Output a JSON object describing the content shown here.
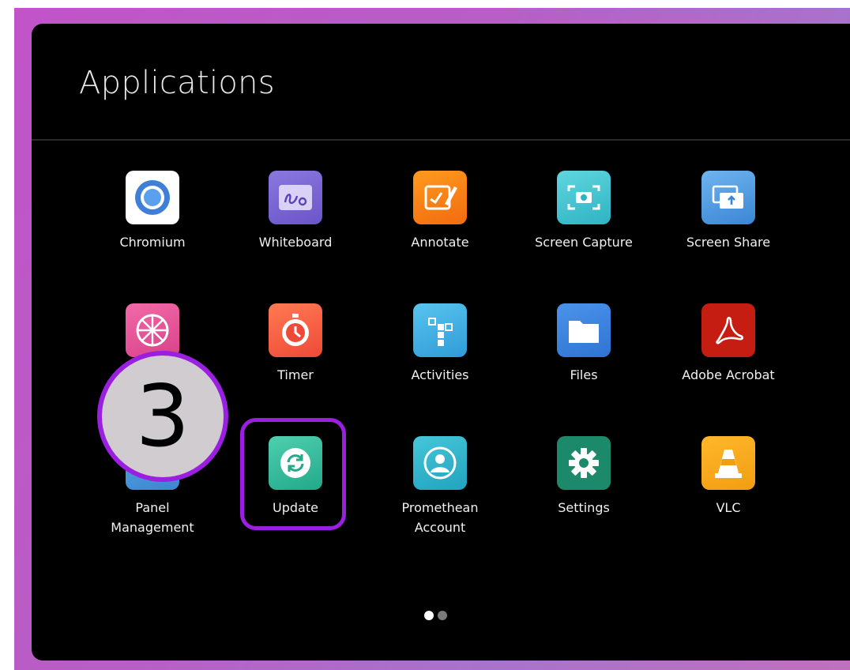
{
  "header": {
    "title": "Applications"
  },
  "apps": [
    {
      "label": "Chromium",
      "icon": "chromium-icon"
    },
    {
      "label": "Whiteboard",
      "icon": "whiteboard-icon"
    },
    {
      "label": "Annotate",
      "icon": "annotate-icon"
    },
    {
      "label": "Screen Capture",
      "icon": "screen-capture-icon"
    },
    {
      "label": "Screen Share",
      "icon": "screen-share-icon"
    },
    {
      "label": "",
      "icon": "spinner-icon"
    },
    {
      "label": "Timer",
      "icon": "timer-icon"
    },
    {
      "label": "Activities",
      "icon": "activities-icon"
    },
    {
      "label": "Files",
      "icon": "folder-icon"
    },
    {
      "label": "Adobe Acrobat",
      "icon": "acrobat-icon"
    },
    {
      "label_line1": "Panel",
      "label_line2": "Management",
      "icon": "panel-management-icon"
    },
    {
      "label": "Update",
      "icon": "update-icon"
    },
    {
      "label_line1": "Promethean",
      "label_line2": "Account",
      "icon": "account-icon"
    },
    {
      "label": "Settings",
      "icon": "gear-icon"
    },
    {
      "label": "VLC",
      "icon": "vlc-cone-icon"
    }
  ],
  "pagination": {
    "pages": 2,
    "current": 1
  },
  "annotation": {
    "step_number": "3",
    "highlight_color": "#9b1fe0"
  },
  "colors": {
    "background": "#000000",
    "accent": "#9b1fe0"
  }
}
